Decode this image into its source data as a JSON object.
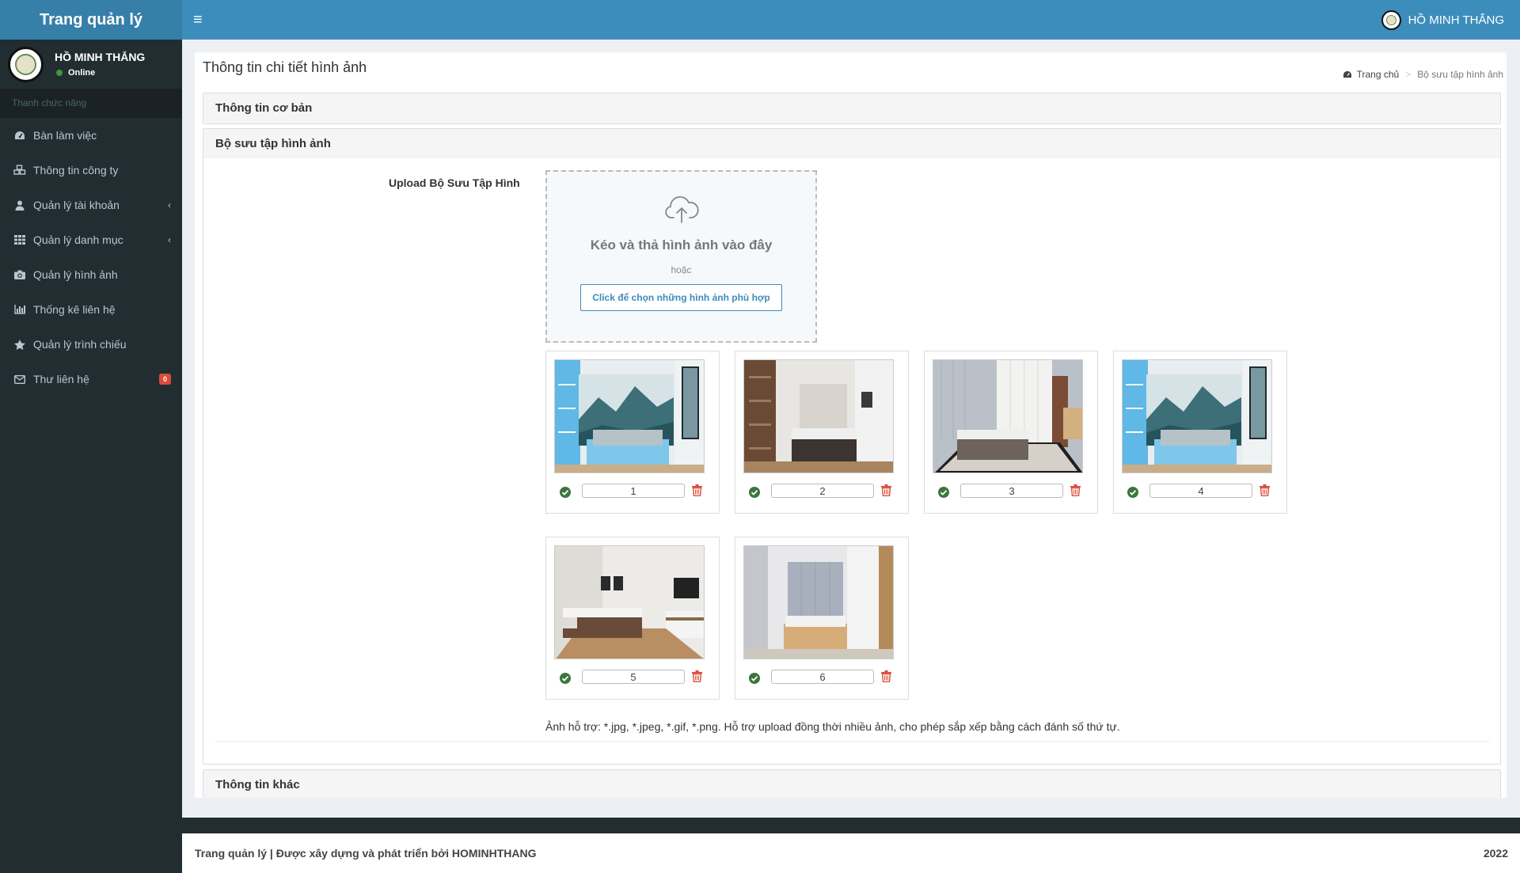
{
  "app": {
    "title": "Trang quản lý"
  },
  "user": {
    "name": "HỒ MINH THẮNG",
    "status": "Online"
  },
  "sidebar": {
    "header": "Thanh chức năng",
    "items": [
      {
        "label": "Bàn làm việc",
        "icon": "dashboard-icon"
      },
      {
        "label": "Thông tin công ty",
        "icon": "cubes-icon"
      },
      {
        "label": "Quản lý tài khoản",
        "icon": "user-icon",
        "caret": "‹"
      },
      {
        "label": "Quản lý danh mục",
        "icon": "grid-icon",
        "caret": "‹"
      },
      {
        "label": "Quản lý hình ảnh",
        "icon": "camera-icon"
      },
      {
        "label": "Thống kê liên hệ",
        "icon": "bar-chart-icon"
      },
      {
        "label": "Quản lý trình chiếu",
        "icon": "star-icon"
      },
      {
        "label": "Thư liên hệ",
        "icon": "envelope-icon",
        "badge": "0"
      }
    ]
  },
  "topbar": {
    "menu_icon": "≡",
    "user_name": "HỒ MINH THẮNG"
  },
  "page": {
    "title": "Thông tin chi tiết hình ảnh",
    "breadcrumb": {
      "home": "Trang chủ",
      "separator": ">",
      "current": "Bộ sưu tập hình ảnh"
    }
  },
  "panels": {
    "basic": "Thông tin cơ bản",
    "gallery": "Bộ sưu tập hình ảnh",
    "other": "Thông tin khác"
  },
  "upload": {
    "label": "Upload Bộ Sưu Tập Hình",
    "drop_text": "Kéo và thả hình ảnh vào đây",
    "or_text": "hoặc",
    "button_label": "Click để chọn những hình ảnh phù hợp",
    "help_text": "Ảnh hỗ trợ: *.jpg, *.jpeg, *.gif, *.png. Hỗ trợ upload đồng thời nhiều ảnh, cho phép sắp xếp bằng cách đánh số thứ tự."
  },
  "images": [
    {
      "order": "1",
      "scene": "blue-bedroom-mountain-mural"
    },
    {
      "order": "2",
      "scene": "bedroom-wood-shelving"
    },
    {
      "order": "3",
      "scene": "grey-bedroom-wardrobe"
    },
    {
      "order": "4",
      "scene": "blue-bedroom-mountain-mural"
    },
    {
      "order": "5",
      "scene": "white-bedroom-tv-wall"
    },
    {
      "order": "6",
      "scene": "grey-bedroom-wood-bed"
    }
  ],
  "footer": {
    "text": "Trang quản lý | Được xây dựng và phát triển bởi HOMINHTHANG",
    "year": "2022"
  },
  "colors": {
    "primary": "#3c8dbc",
    "logo_bg": "#367fa9",
    "sidebar_bg": "#222d32",
    "success": "#3c763d",
    "danger": "#dd4b39"
  }
}
